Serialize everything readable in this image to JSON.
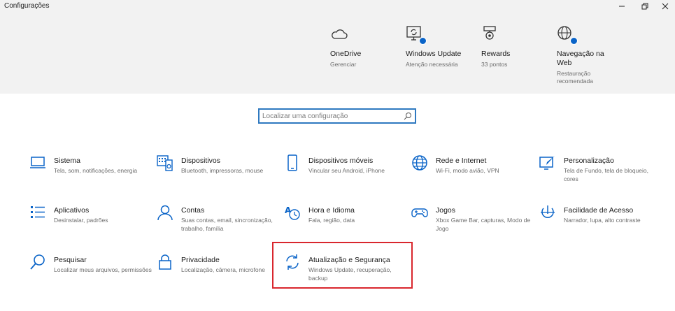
{
  "window": {
    "title": "Configurações"
  },
  "status_cards": [
    {
      "title": "OneDrive",
      "sub": "Gerenciar",
      "icon": "cloud-icon"
    },
    {
      "title": "Windows Update",
      "sub": "Atenção necessária",
      "icon": "windows-update-icon",
      "badge": true
    },
    {
      "title": "Rewards",
      "sub": "33 pontos",
      "icon": "rewards-medal-icon"
    },
    {
      "title": "Navegação na Web",
      "sub": "Restauração recomendada",
      "icon": "globe-icon",
      "badge": true
    }
  ],
  "search": {
    "placeholder": "Localizar uma configuração"
  },
  "categories": [
    {
      "title": "Sistema",
      "sub": "Tela, som, notificações, energia",
      "icon": "laptop-icon"
    },
    {
      "title": "Dispositivos",
      "sub": "Bluetooth, impressoras, mouse",
      "icon": "keyboard-devices-icon"
    },
    {
      "title": "Dispositivos móveis",
      "sub": "Vincular seu Android, iPhone",
      "icon": "phone-icon"
    },
    {
      "title": "Rede e Internet",
      "sub": "Wi-Fi, modo avião, VPN",
      "icon": "globe-network-icon"
    },
    {
      "title": "Personalização",
      "sub": "Tela de Fundo, tela de bloqueio, cores",
      "icon": "paint-brush-icon"
    },
    {
      "title": "Aplicativos",
      "sub": "Desinstalar, padrões",
      "icon": "apps-list-icon"
    },
    {
      "title": "Contas",
      "sub": "Suas contas, email, sincronização, trabalho, família",
      "icon": "person-icon"
    },
    {
      "title": "Hora e Idioma",
      "sub": "Fala, região, data",
      "icon": "time-language-icon"
    },
    {
      "title": "Jogos",
      "sub": "Xbox Game Bar, capturas, Modo de Jogo",
      "icon": "gamepad-icon"
    },
    {
      "title": "Facilidade de Acesso",
      "sub": "Narrador, lupa, alto contraste",
      "icon": "ease-of-access-icon"
    },
    {
      "title": "Pesquisar",
      "sub": "Localizar meus arquivos, permissões",
      "icon": "search-icon"
    },
    {
      "title": "Privacidade",
      "sub": "Localização, câmera, microfone",
      "icon": "lock-icon"
    },
    {
      "title": "Atualização e Segurança",
      "sub": "Windows Update, recuperação, backup",
      "icon": "sync-arrows-icon",
      "highlighted": true
    }
  ],
  "colors": {
    "accent": "#0a64c8",
    "highlight": "#d9272e",
    "header_bg": "#f2f2f2"
  }
}
